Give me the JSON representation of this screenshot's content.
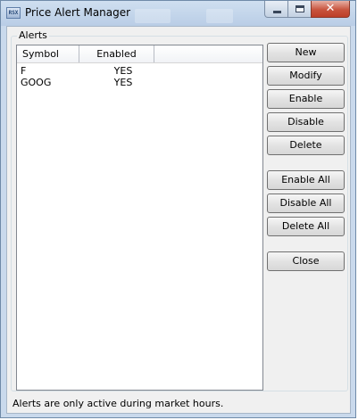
{
  "window": {
    "title": "Price Alert Manager",
    "icon_label": "RSX",
    "accent_color": "#c9d9ec",
    "close_button_color": "#c8543e"
  },
  "caption_buttons": {
    "minimize_icon": "minimize-icon",
    "maximize_icon": "maximize-icon",
    "close_glyph": "✕"
  },
  "alerts_group": {
    "label": "Alerts"
  },
  "alerts_list": {
    "columns": [
      "Symbol",
      "Enabled",
      ""
    ],
    "rows": [
      {
        "symbol": "F",
        "enabled": "YES"
      },
      {
        "symbol": "GOOG",
        "enabled": "YES"
      }
    ]
  },
  "buttons": {
    "new": "New",
    "modify": "Modify",
    "enable": "Enable",
    "disable": "Disable",
    "delete": "Delete",
    "enable_all": "Enable All",
    "disable_all": "Disable All",
    "delete_all": "Delete All",
    "close": "Close"
  },
  "status": {
    "note": "Alerts are only active during market hours."
  }
}
